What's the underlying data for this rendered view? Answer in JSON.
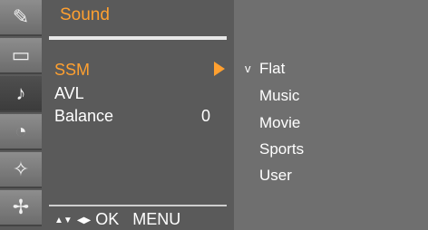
{
  "menu": {
    "title": "Sound",
    "items": [
      {
        "label": "SSM",
        "value": "",
        "selected": true
      },
      {
        "label": "AVL",
        "value": ""
      },
      {
        "label": "Balance",
        "value": "0"
      }
    ]
  },
  "submenu": {
    "check_mark": "v",
    "options": [
      "Flat",
      "Music",
      "Movie",
      "Sports",
      "User"
    ],
    "selected": "Flat"
  },
  "footer": {
    "hint_updown": "▲▼",
    "hint_leftright": "◀▶",
    "ok": "OK",
    "menu": "MENU"
  },
  "icons": [
    "picture-settings-icon",
    "screen-icon",
    "sound-icon",
    "time-icon",
    "special-icon",
    "setup-icon"
  ],
  "colors": {
    "accent": "#ffa030",
    "panel": "#5a5a5a",
    "submenu": "#6f6f6f"
  }
}
